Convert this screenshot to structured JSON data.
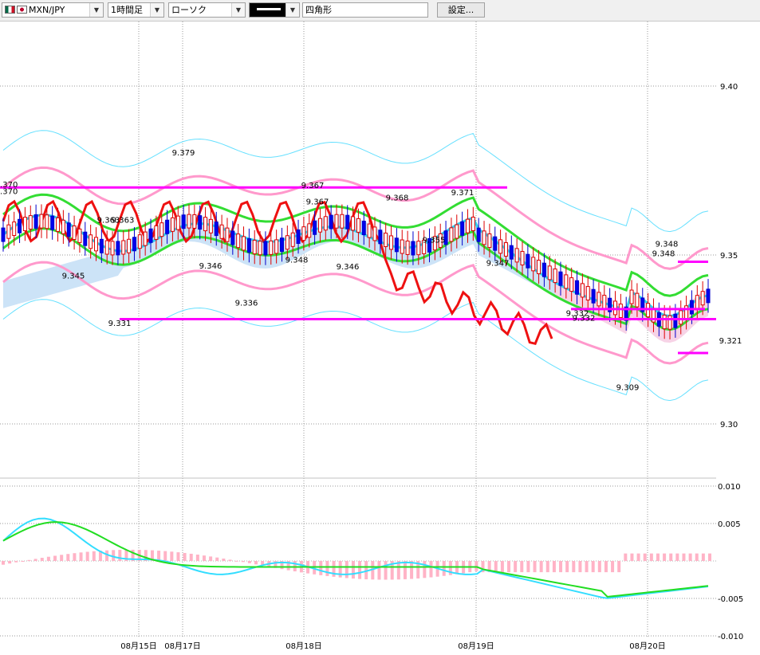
{
  "toolbar": {
    "pair": "MXN/JPY",
    "timeframe": "1時間足",
    "chart_type": "ローソク",
    "tool": "四角形",
    "settings_button": "設定..."
  },
  "chart_data": [
    {
      "type": "candlestick",
      "title": "",
      "y_ticks": [
        "9.40",
        "9.35",
        "9.30"
      ],
      "x_ticks": [
        "08月15日",
        "08月17日",
        "08月18日",
        "08月19日",
        "08月20日"
      ],
      "ylim": [
        9.289,
        9.417
      ],
      "grid": true,
      "price_labels": [
        {
          "text": "9.370",
          "value": 9.37
        },
        {
          "text": "9.370",
          "value": 9.368
        },
        {
          "text": "9.379",
          "value": 9.3795
        },
        {
          "text": "9.363",
          "value": 9.3595
        },
        {
          "text": "9.363",
          "value": 9.3595
        },
        {
          "text": "9.345",
          "value": 9.343
        },
        {
          "text": "9.331",
          "value": 9.329
        },
        {
          "text": "9.346",
          "value": 9.346
        },
        {
          "text": "9.336",
          "value": 9.335
        },
        {
          "text": "9.367",
          "value": 9.3698
        },
        {
          "text": "9.367",
          "value": 9.365
        },
        {
          "text": "9.348",
          "value": 9.3478
        },
        {
          "text": "9.346",
          "value": 9.3458
        },
        {
          "text": "9.368",
          "value": 9.3662
        },
        {
          "text": "9.355",
          "value": 9.3537
        },
        {
          "text": "9.371",
          "value": 9.3677
        },
        {
          "text": "9.347",
          "value": 9.3468
        },
        {
          "text": "9.332",
          "value": 9.332
        },
        {
          "text": "9.332",
          "value": 9.3305
        },
        {
          "text": "9.309",
          "value": 9.31
        },
        {
          "text": "9.348",
          "value": 9.3525
        },
        {
          "text": "9.348",
          "value": 9.3497
        },
        {
          "text": "9.321",
          "value": 9.3238
        }
      ],
      "horizontal_lines": [
        {
          "value": 9.37,
          "color": "#ff00ff"
        },
        {
          "value": 9.331,
          "color": "#ff00ff"
        },
        {
          "value": 9.334,
          "color": "#ff00ff"
        },
        {
          "value": 9.348,
          "color": "#ff00ff"
        },
        {
          "value": 9.321,
          "color": "#ff00ff"
        }
      ]
    },
    {
      "type": "macd",
      "y_ticks": [
        "0.010",
        "0.005",
        "-0.005",
        "-0.010"
      ],
      "ylim": [
        -0.0102,
        0.0106
      ],
      "grid": true
    }
  ]
}
